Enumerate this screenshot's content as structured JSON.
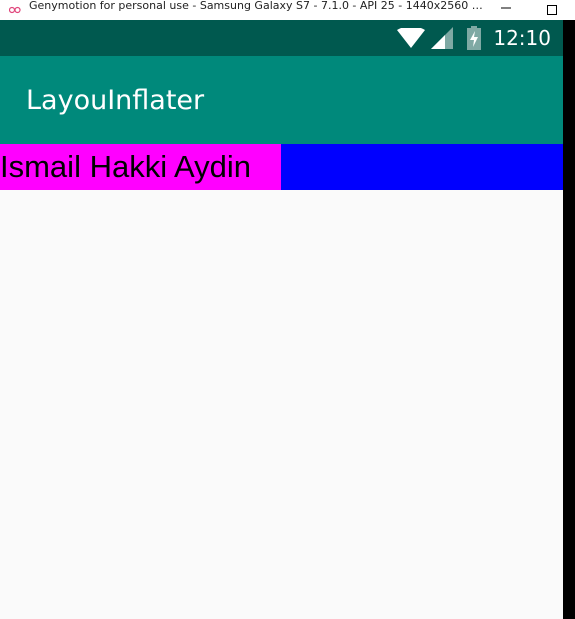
{
  "window": {
    "title": "Genymotion for personal use - Samsung Galaxy S7 - 7.1.0 - API 25 - 1440x2560 (144...",
    "minimize_icon": "minimize-icon",
    "maximize_icon": "maximize-icon"
  },
  "status_bar": {
    "time": "12:10",
    "icons": [
      "wifi-icon",
      "signal-icon",
      "battery-charging-icon"
    ],
    "color": "#00594f"
  },
  "app_bar": {
    "title": "LayouInflater",
    "color": "#00897b"
  },
  "content": {
    "row_background": "#0000ff",
    "label_background": "#ff00ff",
    "label_text": "Ismail Hakki Aydin"
  }
}
